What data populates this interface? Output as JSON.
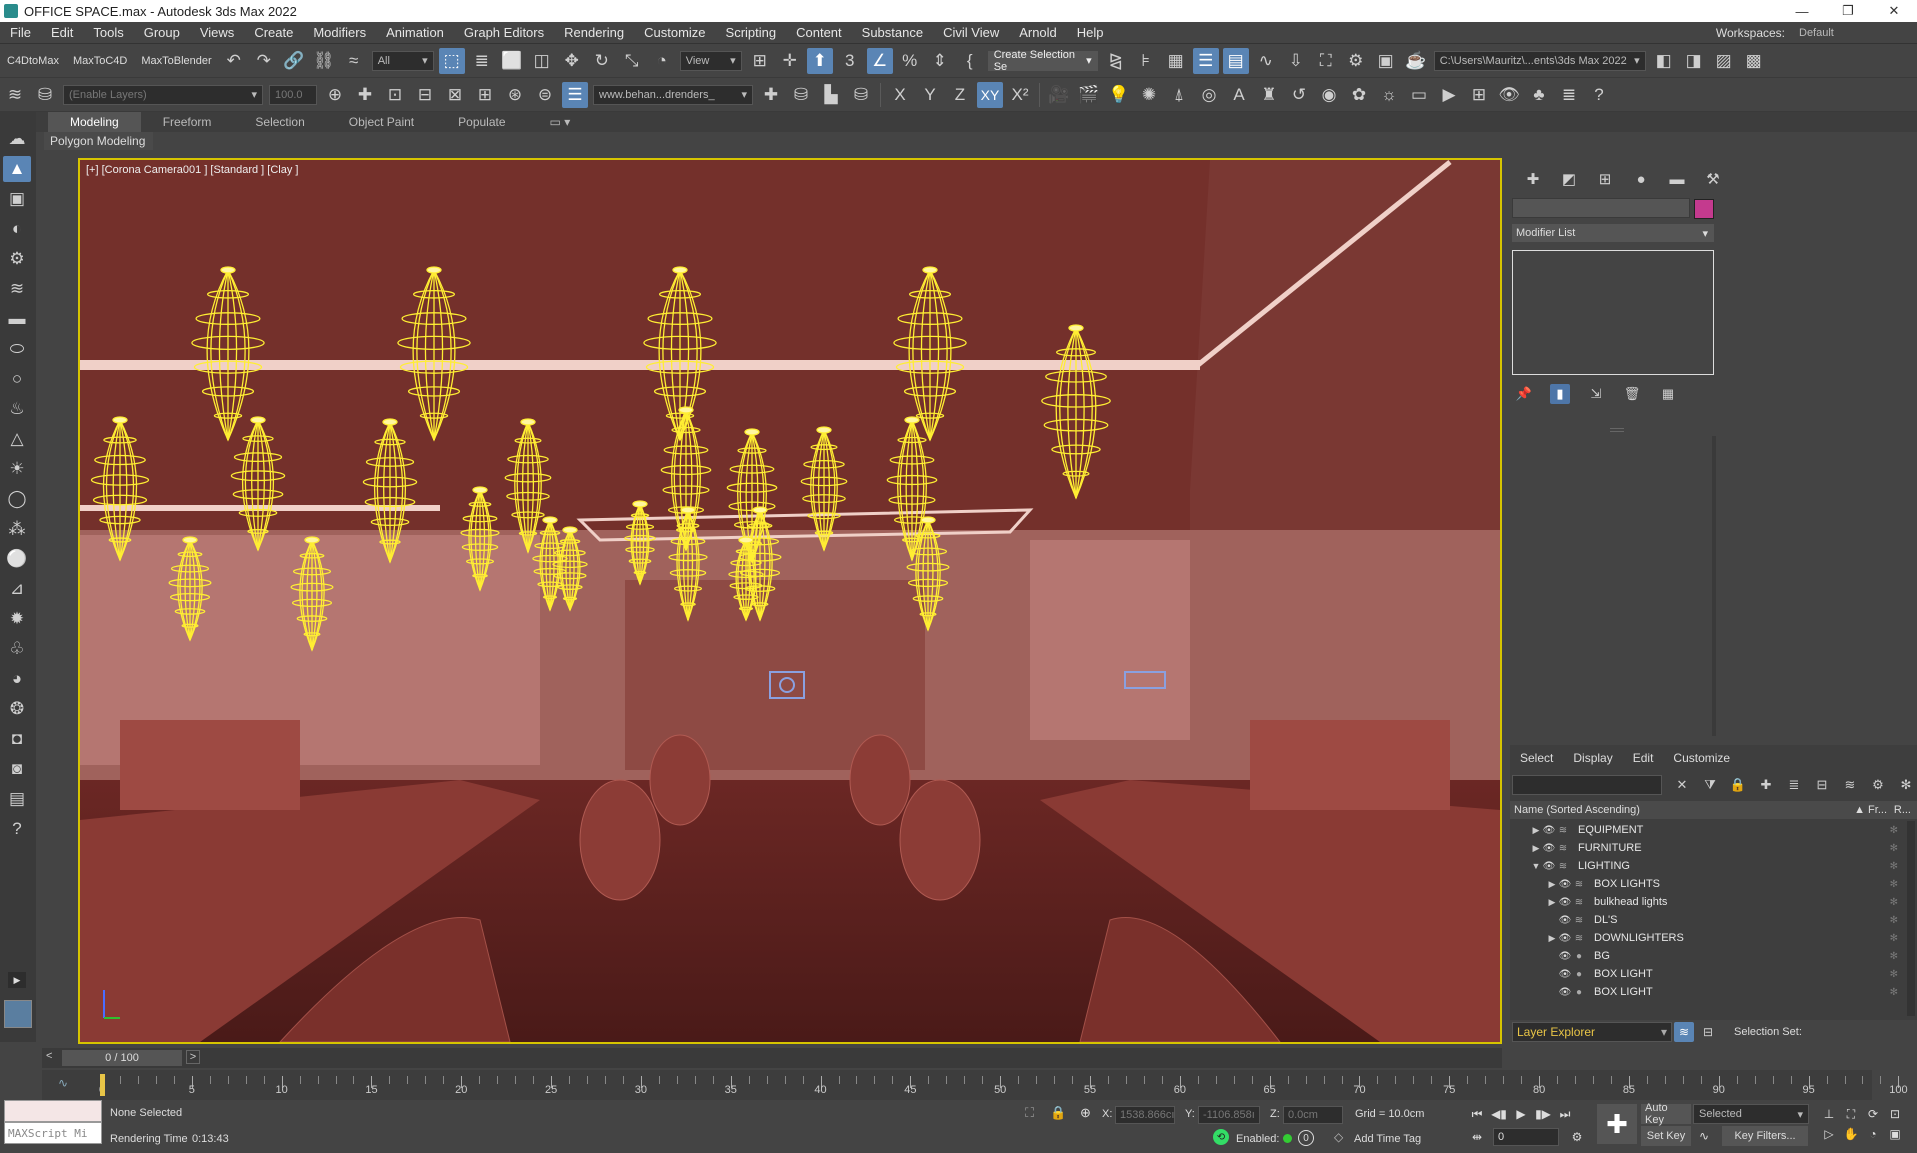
{
  "window": {
    "title": "OFFICE SPACE.max - Autodesk 3ds Max 2022",
    "minimize": "—",
    "maximize": "❐",
    "close": "✕"
  },
  "menu": [
    "File",
    "Edit",
    "Tools",
    "Group",
    "Views",
    "Create",
    "Modifiers",
    "Animation",
    "Graph Editors",
    "Rendering",
    "Customize",
    "Scripting",
    "Content",
    "Substance",
    "Civil View",
    "Arnold",
    "Help"
  ],
  "workspace": {
    "label": "Workspaces:",
    "value": "Default"
  },
  "toolbar1": {
    "c4dtomax": "C4DtoMax",
    "maxtoc4d": "MaxToC4D",
    "maxtoblender": "MaxToBlender",
    "filter": "All",
    "refcoord": "View",
    "selset": "Create Selection Se",
    "path": "C:\\Users\\Mauritz\\...ents\\3ds Max 2022"
  },
  "toolbar2": {
    "layer_field": "(Enable Layers)",
    "layer_value": "100.0",
    "scene": "www.behan...drenders_",
    "axes": [
      "X",
      "Y",
      "Z",
      "XY",
      "X²"
    ]
  },
  "ribbon": {
    "tabs": [
      "Modeling",
      "Freeform",
      "Selection",
      "Object Paint",
      "Populate"
    ],
    "active": "Modeling",
    "sub": "Polygon Modeling"
  },
  "viewport": {
    "label": "[+] [Corona Camera001 ] [Standard ] [Clay ]",
    "bg": "#6e2a26",
    "wire": "#ffee33"
  },
  "cmdpanel": {
    "modifier_list": "Modifier List",
    "color": "#c43a8e"
  },
  "scene_explorer": {
    "menu": [
      "Select",
      "Display",
      "Edit",
      "Customize"
    ],
    "col_name": "Name (Sorted Ascending)",
    "col_fr": "▲ Fr...",
    "col_r": "R...",
    "rows": [
      {
        "label": "EQUIPMENT",
        "indent": 1,
        "tri": "▶",
        "icon": "layer"
      },
      {
        "label": "FURNITURE",
        "indent": 1,
        "tri": "▶",
        "icon": "layer"
      },
      {
        "label": "LIGHTING",
        "indent": 1,
        "tri": "▼",
        "icon": "layer"
      },
      {
        "label": "BOX LIGHTS",
        "indent": 2,
        "tri": "▶",
        "icon": "layer"
      },
      {
        "label": "bulkhead lights",
        "indent": 2,
        "tri": "▶",
        "icon": "layer"
      },
      {
        "label": "DL'S",
        "indent": 2,
        "tri": "",
        "icon": "layer"
      },
      {
        "label": "DOWNLIGHTERS",
        "indent": 2,
        "tri": "▶",
        "icon": "layer"
      },
      {
        "label": "BG",
        "indent": 2,
        "tri": "",
        "icon": "obj"
      },
      {
        "label": "BOX LIGHT",
        "indent": 2,
        "tri": "",
        "icon": "obj"
      },
      {
        "label": "BOX LIGHT",
        "indent": 2,
        "tri": "",
        "icon": "obj"
      }
    ],
    "layer_explorer": "Layer Explorer",
    "selection_set": "Selection Set:"
  },
  "timeline": {
    "position": "0 / 100",
    "labels": [
      "0",
      "5",
      "10",
      "15",
      "20",
      "25",
      "30",
      "35",
      "40",
      "45",
      "50",
      "55",
      "60",
      "65",
      "70",
      "75",
      "80",
      "85",
      "90",
      "95",
      "100"
    ]
  },
  "status": {
    "maxscript": "MAXScript Mi",
    "selection": "None Selected",
    "render_time_label": "Rendering Time",
    "render_time": "0:13:43",
    "x_label": "X:",
    "x": "1538.866cı",
    "y_label": "Y:",
    "y": "-1106.858ı",
    "z_label": "Z:",
    "z": "0.0cm",
    "grid": "Grid = 10.0cm",
    "enabled": "Enabled:",
    "add_time_tag": "Add Time Tag",
    "auto_key": "Auto Key",
    "set_key": "Set Key",
    "selected": "Selected",
    "key_filters": "Key Filters...",
    "frame": "0"
  }
}
